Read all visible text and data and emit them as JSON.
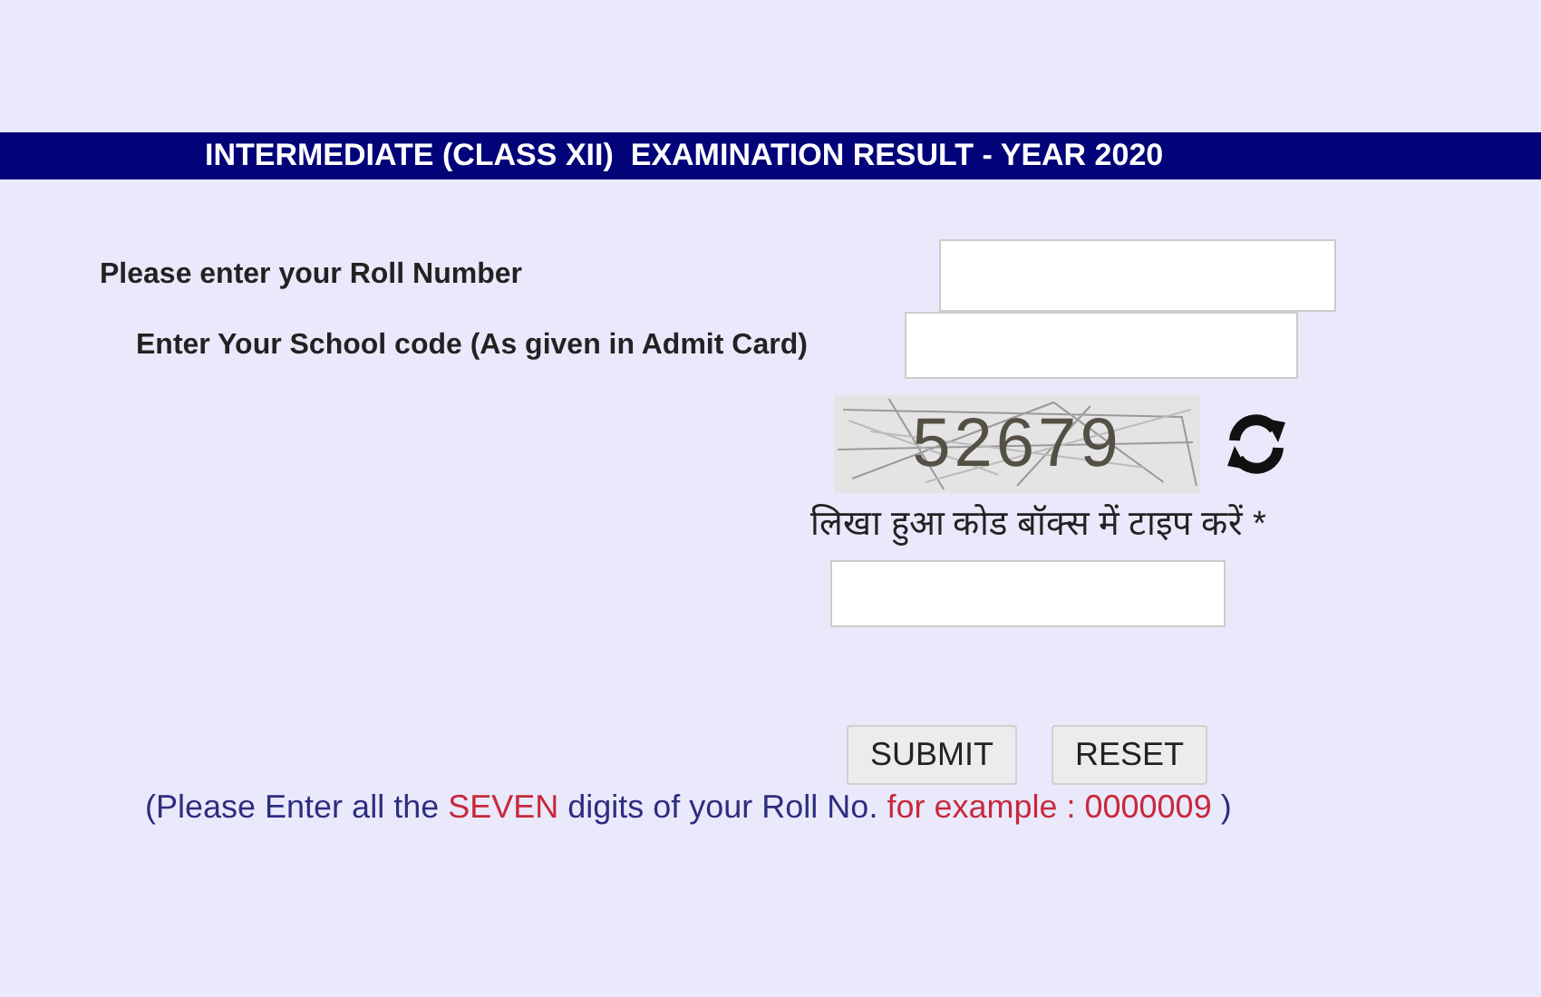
{
  "header": {
    "title": "INTERMEDIATE (CLASS XII)  EXAMINATION RESULT - YEAR 2020"
  },
  "fields": [
    {
      "label": "Please enter your Roll Number"
    },
    {
      "label": "Enter Your School code (As given in Admit Card)"
    }
  ],
  "captcha": {
    "code": "52679",
    "label": "लिखा हुआ कोड बॉक्स में टाइप करें *"
  },
  "buttons": [
    "SUBMIT",
    "RESET"
  ],
  "hint": [
    {
      "kind": "normal",
      "text": "(Please Enter all the "
    },
    {
      "kind": "highlight",
      "text": "SEVEN"
    },
    {
      "kind": "normal",
      "text": " digits of your Roll No. "
    },
    {
      "kind": "highlight",
      "text": "for example : 0000009"
    },
    {
      "kind": "normal",
      "text": " )"
    }
  ]
}
